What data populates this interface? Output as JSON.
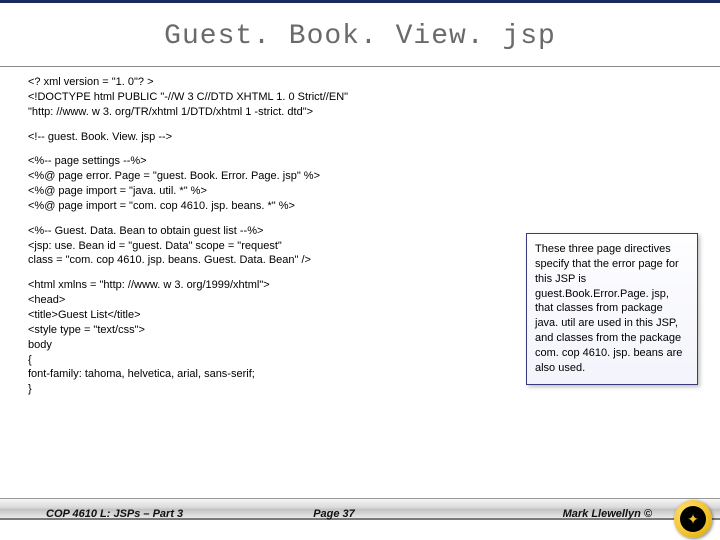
{
  "title": "Guest. Book. View. jsp",
  "code": {
    "l1": "<? xml version = \"1. 0\"? >",
    "l2": "<!DOCTYPE html PUBLIC \"-//W 3 C//DTD XHTML 1. 0 Strict//EN\"",
    "l3": "   \"http: //www. w 3. org/TR/xhtml 1/DTD/xhtml 1 -strict. dtd\">",
    "l4": "<!-- guest. Book. View. jsp -->",
    "l5": "<%-- page settings --%>",
    "l6": "<%@ page error. Page = \"guest. Book. Error. Page. jsp\" %>",
    "l7": "<%@ page import = \"java. util. *\" %>",
    "l8": "<%@ page import = \"com. cop 4610. jsp. beans. *\" %>",
    "l9": "<%-- Guest. Data. Bean to obtain guest list --%>",
    "l10": "<jsp: use. Bean id = \"guest. Data\" scope = \"request\"",
    "l11": "   class = \"com. cop 4610. jsp. beans. Guest. Data. Bean\" />",
    "l12": "<html xmlns = \"http: //www. w 3. org/1999/xhtml\">",
    "l13": "   <head>",
    "l14": "      <title>Guest List</title>",
    "l15": "      <style type = \"text/css\">",
    "l16": "      body",
    "l17": "                                  {",
    "l18": "         font-family: tahoma, helvetica, arial, sans-serif;",
    "l19": "      }"
  },
  "callout": "These three page directives specify that the error page for this JSP is guest.Book.Error.Page. jsp, that classes from package java. util are used in this JSP, and classes from the package com. cop 4610. jsp. beans are also used.",
  "footer": {
    "left": "COP 4610 L: JSPs – Part 3",
    "center": "Page 37",
    "right": "Mark Llewellyn ©"
  }
}
